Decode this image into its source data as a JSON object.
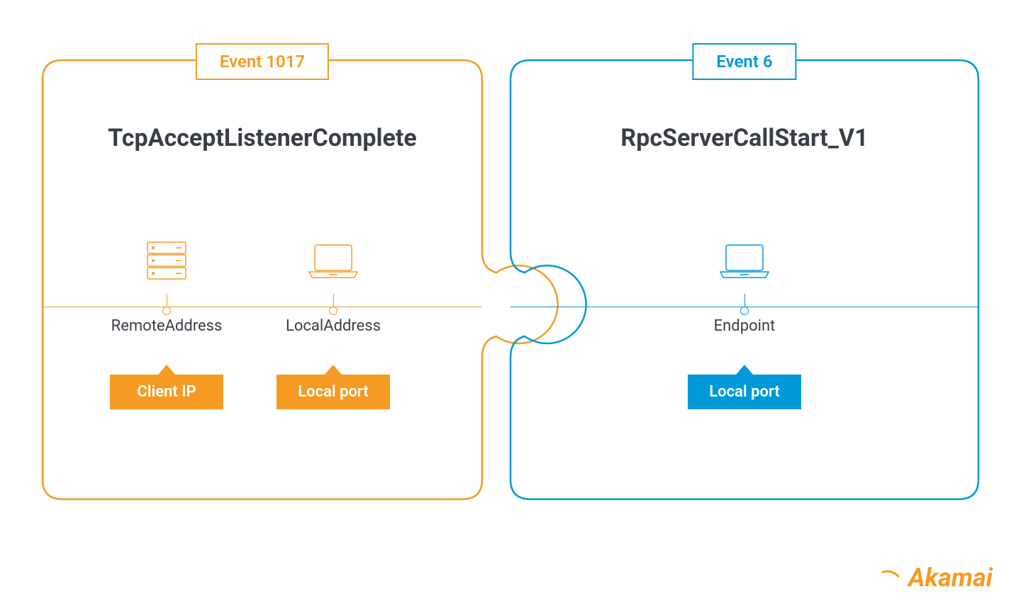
{
  "colors": {
    "orange": "#f59b24",
    "blue": "#0099d8",
    "text": "#3a3f47"
  },
  "left": {
    "event_label": "Event 1017",
    "title": "TcpAcceptListenerComplete",
    "nodes": [
      {
        "label": "RemoteAddress",
        "callout": "Client IP",
        "icon": "server"
      },
      {
        "label": "LocalAddress",
        "callout": "Local port",
        "icon": "laptop"
      }
    ]
  },
  "right": {
    "event_label": "Event 6",
    "title": "RpcServerCallStart_V1",
    "nodes": [
      {
        "label": "Endpoint",
        "callout": "Local port",
        "icon": "laptop"
      }
    ]
  },
  "brand": {
    "name": "Akamai"
  }
}
